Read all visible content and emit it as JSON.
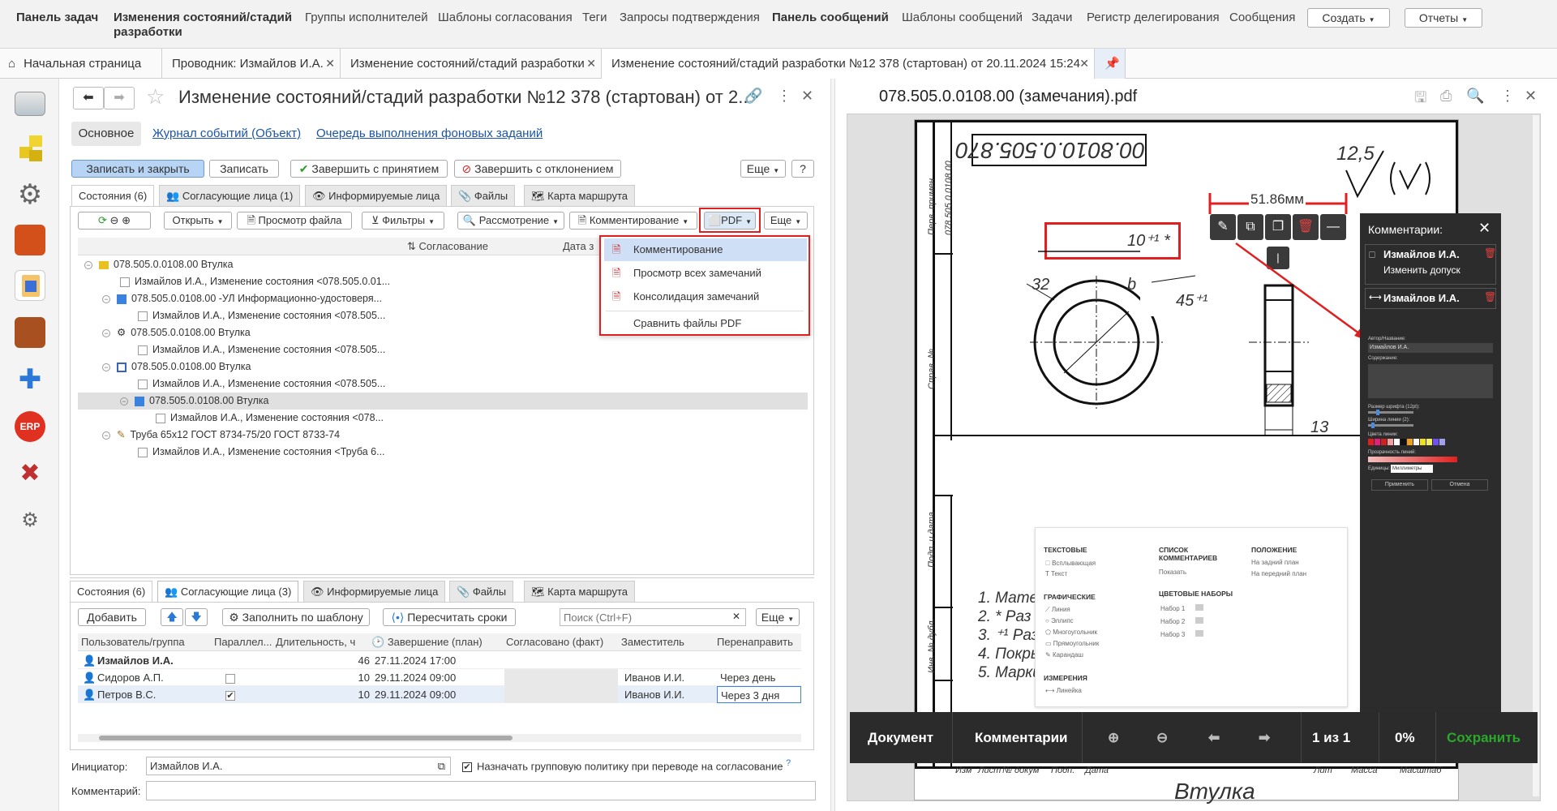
{
  "top_nav": {
    "items": [
      {
        "label": "Панель задач",
        "bold": true
      },
      {
        "label": "Изменения состояний/стадий разработки",
        "bold": true
      },
      {
        "label": "Группы исполнителей",
        "bold": false
      },
      {
        "label": "Шаблоны согласования",
        "bold": false
      },
      {
        "label": "Теги",
        "bold": false
      },
      {
        "label": "Запросы подтверждения",
        "bold": false
      },
      {
        "label": "Панель сообщений",
        "bold": true
      },
      {
        "label": "Шаблоны сообщений",
        "bold": false
      },
      {
        "label": "Задачи",
        "bold": false
      },
      {
        "label": "Регистр делегирования",
        "bold": false
      },
      {
        "label": "Сообщения",
        "bold": false
      }
    ],
    "create_label": "Создать",
    "reports_label": "Отчеты"
  },
  "open_tabs": [
    "Начальная страница",
    "Проводник: Измайлов И.А.",
    "Изменение состояний/стадий разработки",
    "Изменение состояний/стадий разработки №12 378 (стартован) от 20.11.2024 15:24"
  ],
  "document": {
    "title": "Изменение состояний/стадий разработки №12 378 (стартован) от 2...",
    "subtabs": [
      "Основное",
      "Журнал событий (Объект)",
      "Очередь выполнения фоновых заданий"
    ],
    "buttons": {
      "save_close": "Записать и закрыть",
      "save": "Записать",
      "finish_accept": "Завершить с принятием",
      "finish_reject": "Завершить с отклонением",
      "more": "Еще",
      "help": "?"
    }
  },
  "upper_tabs": [
    "Состояния (6)",
    "Согласующие лица (1)",
    "Информируемые лица",
    "Файлы",
    "Карта маршрута"
  ],
  "toolbar": {
    "open": "Открыть",
    "view_file": "Просмотр файла",
    "filters": "Фильтры",
    "review": "Рассмотрение",
    "commenting": "Комментирование",
    "pdf": "PDF",
    "more": "Еще"
  },
  "tree_headers": {
    "approval": "Согласование",
    "date": "Дата з"
  },
  "tree": [
    {
      "text": "078.505.0.0108.00 Втулка",
      "level": 0,
      "toggle": "−",
      "icon": "folder"
    },
    {
      "text": "Измайлов И.А., Изменение состояния <078.505.0.01...",
      "level": 1,
      "toggle": "",
      "icon": "checkbox"
    },
    {
      "text": "078.505.0.0108.00 -УЛ Информационно-удостоверя...",
      "level": 1,
      "toggle": "−",
      "icon": "doc-blue"
    },
    {
      "text": "Измайлов И.А., Изменение состояния <078.505...",
      "level": 2,
      "toggle": "",
      "icon": "checkbox"
    },
    {
      "text": "078.505.0.0108.00 Втулка",
      "level": 1,
      "toggle": "−",
      "icon": "gear"
    },
    {
      "text": "Измайлов И.А., Изменение состояния <078.505...",
      "level": 2,
      "toggle": "",
      "icon": "checkbox"
    },
    {
      "text": "078.505.0.0108.00 Втулка",
      "level": 1,
      "toggle": "−",
      "icon": "doc-blue2"
    },
    {
      "text": "Измайлов И.А., Изменение состояния <078.505...",
      "level": 2,
      "toggle": "",
      "icon": "checkbox"
    },
    {
      "text": "078.505.0.0108.00 Втулка",
      "level": 2,
      "toggle": "−",
      "icon": "doc-blue",
      "selected": true
    },
    {
      "text": "Измайлов И.А., Изменение состояния <078...",
      "level": 3,
      "toggle": "",
      "icon": "checkbox"
    },
    {
      "text": "Труба 65х12 ГОСТ 8734-75/20 ГОСТ 8733-74",
      "level": 1,
      "toggle": "−",
      "icon": "tool"
    },
    {
      "text": "Измайлов И.А., Изменение состояния <Труба 6...",
      "level": 2,
      "toggle": "",
      "icon": "checkbox"
    }
  ],
  "pdf_menu": [
    "Комментирование",
    "Просмотр всех замечаний",
    "Консолидация замечаний",
    "Сравнить файлы PDF"
  ],
  "lower_tabs": [
    "Состояния (6)",
    "Согласующие лица (3)",
    "Информируемые лица",
    "Файлы",
    "Карта маршрута"
  ],
  "lower_toolbar": {
    "add": "Добавить",
    "fill_template": "Заполнить по шаблону",
    "recalc": "Пересчитать сроки",
    "search_placeholder": "Поиск (Ctrl+F)",
    "more": "Еще"
  },
  "grid": {
    "headers": [
      "Пользователь/группа",
      "Параллел...",
      "Длительность, ч",
      "Завершение (план)",
      "Согласовано (факт)",
      "Заместитель",
      "Перенаправить"
    ],
    "rows": [
      {
        "user": "Измайлов И.А.",
        "parallel": "",
        "duration": "46",
        "plan": "27.11.2024 17:00",
        "fact": "",
        "deputy": "",
        "redirect": "",
        "bold": true
      },
      {
        "user": "Сидоров А.П.",
        "parallel": "unchecked",
        "duration": "10",
        "plan": "29.11.2024 09:00",
        "fact": "",
        "deputy": "Иванов И.И.",
        "redirect": "Через день"
      },
      {
        "user": "Петров В.С.",
        "parallel": "checked",
        "duration": "10",
        "plan": "29.11.2024 09:00",
        "fact": "",
        "deputy": "Иванов И.И.",
        "redirect": "Через 3 дня"
      }
    ]
  },
  "footer": {
    "initiator_label": "Инициатор:",
    "initiator_value": "Измайлов И.А.",
    "group_policy": "Назначать групповую политику при переводе на согласование",
    "help": "?",
    "comment_label": "Комментарий:"
  },
  "viewer": {
    "filename": "078.505.0.0108.00 (замечания).pdf",
    "drawing": {
      "code": "00.8010.0.505.870",
      "side_code": "078.505.0.0108.00",
      "dimension": "51.86мм",
      "tolerance": "10⁺¹ *",
      "dim_32": "32",
      "dim_b": "b",
      "dim_45": "45⁺¹",
      "dim_13": "13",
      "roughness": "12,5",
      "perv_primen": "Перв. примен",
      "sprav": "Справ. №",
      "podp_data": "Подп. и дата",
      "inv": "Инв. № дубл.",
      "notes": [
        "1. Матер",
        "2. * Раз",
        "3. ⁺¹ Раз",
        "4. Покры",
        "5. Марки"
      ],
      "stamp_cols": [
        "Изм",
        "Лист",
        "№ докум",
        "Подп.",
        "Дата"
      ],
      "stamp_right": [
        "Лит",
        "Масса",
        "Масштаб"
      ],
      "stamp_title": "Втулка"
    },
    "toolbox": {
      "text_title": "ТЕКСТОВЫЕ",
      "text_items": [
        "Всплывающая",
        "Текст"
      ],
      "graphic_title": "ГРАФИЧЕСКИЕ",
      "graphic_items": [
        "Линия",
        "Эллипс",
        "Многоугольник",
        "Прямоугольник",
        "Карандаш"
      ],
      "measure_title": "ИЗМЕРЕНИЯ",
      "measure_items": [
        "Линейка"
      ],
      "list_title": "СПИСОК КОММЕНТАРИЕВ",
      "list_items": [
        "Показать"
      ],
      "color_title": "ЦВЕТОВЫЕ НАБОРЫ",
      "color_items": [
        "Набор 1",
        "Набор 2",
        "Набор 3"
      ],
      "position_title": "ПОЛОЖЕНИЕ",
      "position_items": [
        "На задний план",
        "На передний план"
      ]
    },
    "comments_panel": {
      "title": "Комментарии:",
      "entries": [
        {
          "author": "Измайлов И.А.",
          "text": "Изменить допуск"
        },
        {
          "author": "Измайлов И.А.",
          "text": ""
        }
      ],
      "author_label": "Автор/Название:",
      "author_value": "Измайлов И.А.",
      "content_label": "Содержание:",
      "font_size_label": "Размер шрифта (12pt):",
      "line_width_label": "Ширина линии (2):",
      "line_color_label": "Цвета линии:",
      "opacity_label": "Прозрачность линий:",
      "units_label": "Единицы:",
      "units_value": "Миллиметры",
      "apply": "Применить",
      "cancel": "Отмена",
      "line_colors": [
        "#e02020",
        "#e0207a",
        "#d02020",
        "#f0a0a0",
        "#fff",
        "#111",
        "#f0a020",
        "#ffffff",
        "#f0e020",
        "#f0f060",
        "#7050f0",
        "#a0a0f0"
      ]
    },
    "bottom_bar": {
      "document": "Документ",
      "comments": "Комментарии",
      "page": "1 из 1",
      "zoom": "0%",
      "save": "Сохранить"
    }
  }
}
